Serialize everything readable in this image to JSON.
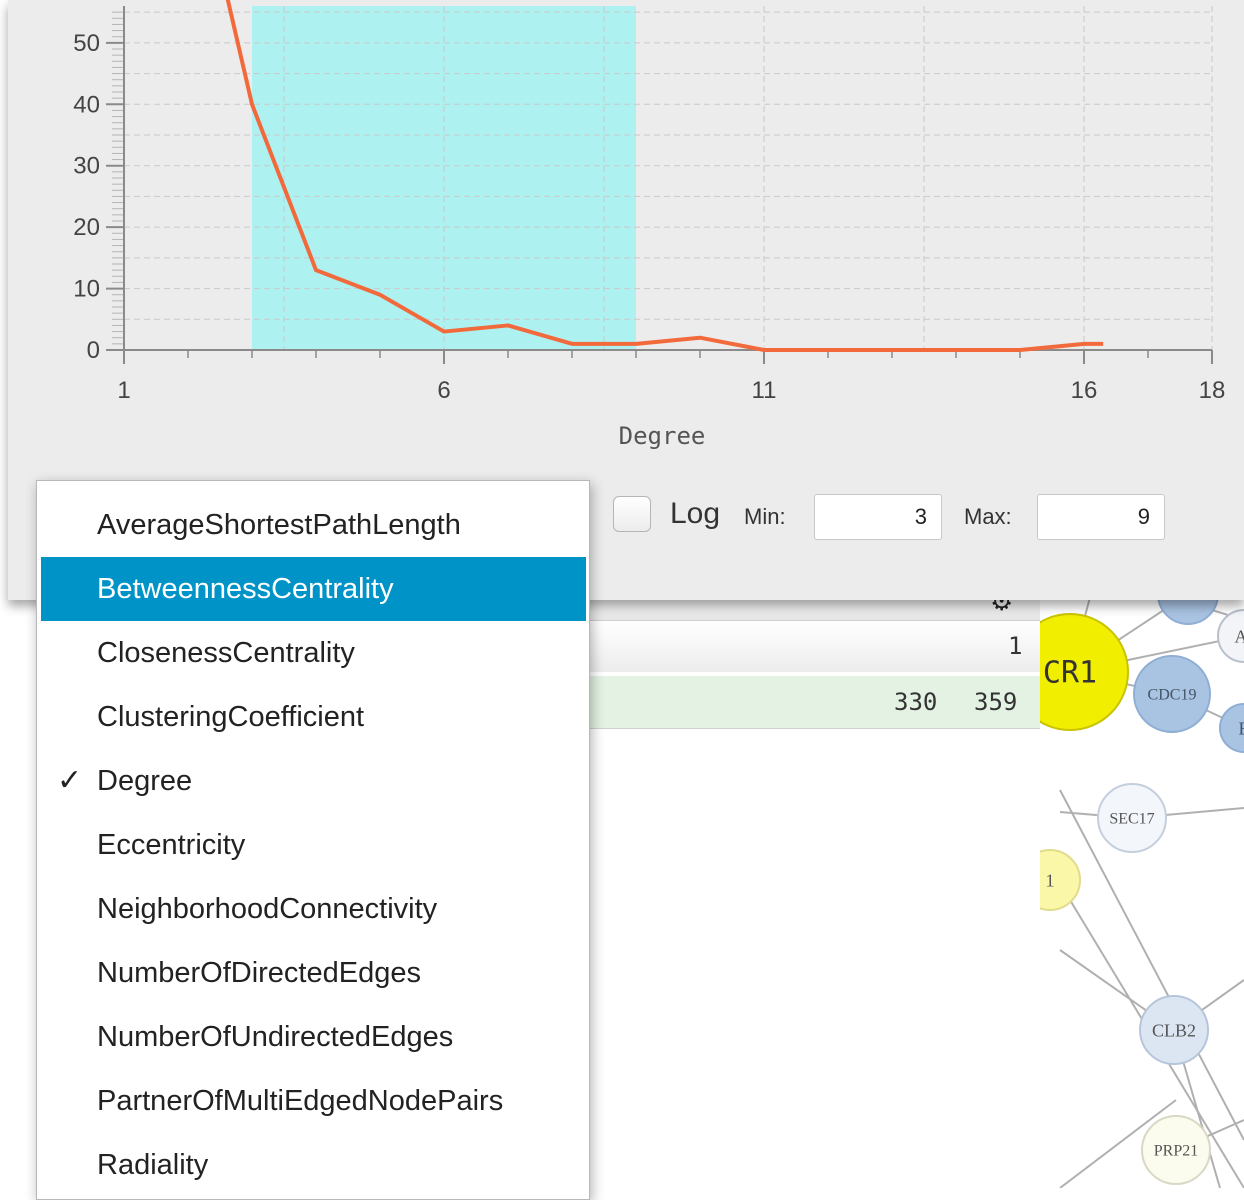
{
  "network": {
    "nodes": [
      {
        "label": "CR1",
        "fill": "#f2ee00",
        "stroke": "#c8c400",
        "text_color": "#333333"
      },
      {
        "label": "CDC19",
        "fill": "#a9c3e3",
        "stroke": "#8faed4",
        "text_color": "#445566"
      },
      {
        "label": "SEC17",
        "fill": "#f3f6fb",
        "stroke": "#c4cfdd",
        "text_color": "#555555"
      },
      {
        "label": "CLB2",
        "fill": "#dce6f3",
        "stroke": "#b6c6da",
        "text_color": "#555555"
      },
      {
        "label": "PRP21",
        "fill": "#fbfbee",
        "stroke": "#d8d8c4",
        "text_color": "#555555"
      },
      {
        "label": "1",
        "fill": "#fbf7a8",
        "stroke": "#e0dc8c",
        "text_color": "#555555"
      },
      {
        "label": "AI",
        "fill": "#f2f4f7",
        "stroke": "#b8c0cc",
        "text_color": "#555555"
      },
      {
        "label": "E",
        "fill": "#a9c3e3",
        "stroke": "#8faed4",
        "text_color": "#445566"
      },
      {
        "label": "",
        "fill": "#a9c3e3",
        "stroke": "#8faed4",
        "text_color": "#445566"
      }
    ]
  },
  "table": {
    "row1": {
      "value": "1"
    },
    "row2": {
      "col_a": "330",
      "col_b": "359"
    }
  },
  "chart_data": {
    "type": "line",
    "xlabel": "Degree",
    "ylabel": "",
    "xlim": [
      1,
      18
    ],
    "ylim": [
      0,
      56
    ],
    "x_ticks": [
      1,
      6,
      11,
      16,
      18
    ],
    "y_ticks": [
      0,
      10,
      20,
      30,
      40,
      50
    ],
    "grid": true,
    "series": [
      {
        "color": "#f26a3c",
        "x": [
          2.6,
          3,
          4,
          5,
          6,
          7,
          8,
          9,
          10,
          11,
          12,
          13,
          14,
          15,
          16,
          16.3
        ],
        "y": [
          70,
          40,
          13,
          9,
          3,
          4,
          1,
          1,
          2,
          0,
          0,
          0,
          0,
          0,
          1,
          1
        ]
      }
    ],
    "highlight_range": [
      3,
      9
    ],
    "highlight_color": "#aef1f1"
  },
  "filter": {
    "log_label": "Log",
    "log_checked": false,
    "min_label": "Min:",
    "min_value": "3",
    "max_label": "Max:",
    "max_value": "9"
  },
  "attribute_menu": {
    "items": [
      {
        "label": "AverageShortestPathLength",
        "checked": false,
        "selected": false
      },
      {
        "label": "BetweennessCentrality",
        "checked": false,
        "selected": true
      },
      {
        "label": "ClosenessCentrality",
        "checked": false,
        "selected": false
      },
      {
        "label": "ClusteringCoefficient",
        "checked": false,
        "selected": false
      },
      {
        "label": "Degree",
        "checked": true,
        "selected": false
      },
      {
        "label": "Eccentricity",
        "checked": false,
        "selected": false
      },
      {
        "label": "NeighborhoodConnectivity",
        "checked": false,
        "selected": false
      },
      {
        "label": "NumberOfDirectedEdges",
        "checked": false,
        "selected": false
      },
      {
        "label": "NumberOfUndirectedEdges",
        "checked": false,
        "selected": false
      },
      {
        "label": "PartnerOfMultiEdgedNodePairs",
        "checked": false,
        "selected": false
      },
      {
        "label": "Radiality",
        "checked": false,
        "selected": false
      }
    ],
    "check_glyph": "✓"
  }
}
